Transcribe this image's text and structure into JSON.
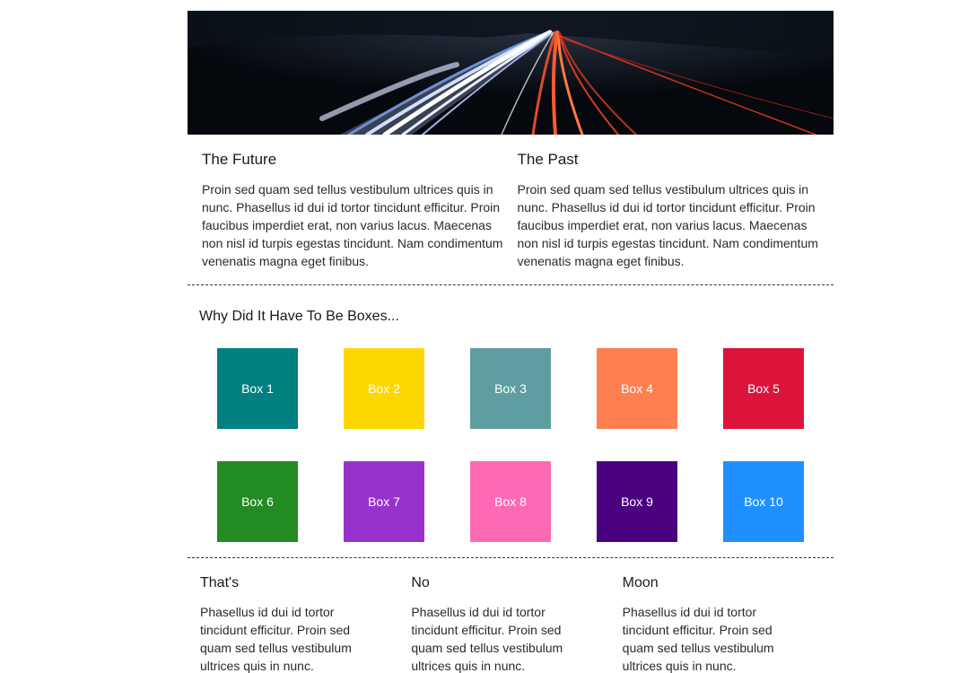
{
  "hero": {
    "image_icon": "highway-light-trails-image"
  },
  "articles": [
    {
      "title": "The Future",
      "body": "Proin sed quam sed tellus vestibulum ultrices quis in nunc. Phasellus id dui id tortor tincidunt efficitur. Proin faucibus imperdiet erat, non varius lacus. Maecenas non nisl id turpis egestas tincidunt. Nam condimentum venenatis magna eget finibus."
    },
    {
      "title": "The Past",
      "body": "Proin sed quam sed tellus vestibulum ultrices quis in nunc. Phasellus id dui id tortor tincidunt efficitur. Proin faucibus imperdiet erat, non varius lacus. Maecenas non nisl id turpis egestas tincidunt. Nam condimentum venenatis magna eget finibus."
    }
  ],
  "boxes_section": {
    "heading": "Why Did It Have To Be Boxes...",
    "boxes": [
      {
        "label": "Box 1",
        "color": "#008080"
      },
      {
        "label": "Box 2",
        "color": "#FFD700"
      },
      {
        "label": "Box 3",
        "color": "#5F9EA0"
      },
      {
        "label": "Box 4",
        "color": "#FF7F50"
      },
      {
        "label": "Box 5",
        "color": "#DC143C"
      },
      {
        "label": "Box 6",
        "color": "#228B22"
      },
      {
        "label": "Box 7",
        "color": "#9932CC"
      },
      {
        "label": "Box 8",
        "color": "#FF69B4"
      },
      {
        "label": "Box 9",
        "color": "#4B0082"
      },
      {
        "label": "Box 10",
        "color": "#1E90FF"
      }
    ]
  },
  "footer_columns": [
    {
      "title": "That's",
      "body": "Phasellus id dui id tortor tincidunt efficitur. Proin sed quam sed tellus vestibulum ultrices quis in nunc."
    },
    {
      "title": "No",
      "body": "Phasellus id dui id tortor tincidunt efficitur. Proin sed quam sed tellus vestibulum ultrices quis in nunc."
    },
    {
      "title": "Moon",
      "body": "Phasellus id dui id tortor tincidunt efficitur. Proin sed quam sed tellus vestibulum ultrices quis in nunc."
    }
  ]
}
